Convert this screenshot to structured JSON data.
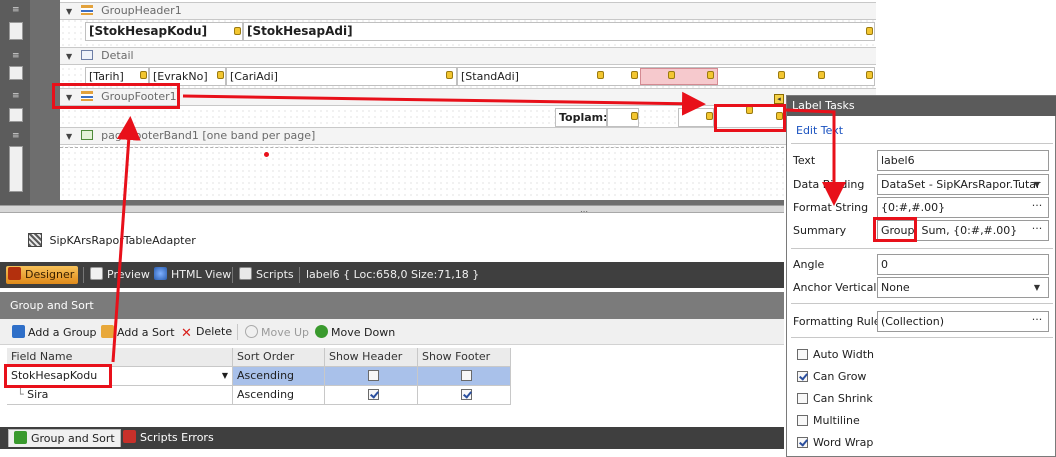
{
  "bands": {
    "group_header": "GroupHeader1",
    "detail": "Detail",
    "group_footer": "GroupFooter1",
    "page_footer": "pageFooterBand1 [one band per page]"
  },
  "header_fields": [
    "[StokHesapKodu]",
    "[StokHesapAdi]"
  ],
  "detail_fields": [
    "[Tarih]",
    "[EvrakNo]",
    "[CariAdi]",
    "[StandAdi]"
  ],
  "footer": {
    "total_label": "Toplam:"
  },
  "tray": {
    "adapter": "SipKArsRaporTableAdapter"
  },
  "designer_tabs": {
    "designer": "Designer",
    "preview": "Preview",
    "html_view": "HTML View",
    "scripts": "Scripts",
    "status": "label6 { Loc:658,0 Size:71,18 }"
  },
  "group_sort": {
    "title": "Group and Sort",
    "toolbar": {
      "add_group": "Add a Group",
      "add_sort": "Add a Sort",
      "delete": "Delete",
      "move_up": "Move Up",
      "move_down": "Move Down"
    },
    "columns": [
      "Field Name",
      "Sort Order",
      "Show Header",
      "Show Footer"
    ],
    "rows": [
      {
        "field": "StokHesapKodu",
        "order": "Ascending",
        "show_header": false,
        "show_footer": false
      },
      {
        "field": "Sira",
        "order": "Ascending",
        "show_header": true,
        "show_footer": true
      }
    ]
  },
  "bottom_tabs": {
    "group_sort": "Group and Sort",
    "scripts_errors": "Scripts Errors"
  },
  "label_tasks": {
    "title": "Label Tasks",
    "edit_text": "Edit Text",
    "text_label": "Text",
    "text_value": "label6",
    "data_binding_label": "Data Binding",
    "data_binding_value": "DataSet - SipKArsRapor.Tutar",
    "format_string_label": "Format String",
    "format_string_value": "{0:#,#.00}",
    "summary_label": "Summary",
    "summary_value": "Group, Sum, {0:#,#.00}",
    "angle_label": "Angle",
    "angle_value": "0",
    "anchor_label": "Anchor Vertically",
    "anchor_value": "None",
    "formatting_rules_label": "Formatting Rules",
    "formatting_rules_value": "(Collection)",
    "checks": [
      {
        "label": "Auto Width",
        "checked": false
      },
      {
        "label": "Can Grow",
        "checked": true
      },
      {
        "label": "Can Shrink",
        "checked": false
      },
      {
        "label": "Multiline",
        "checked": false
      },
      {
        "label": "Word Wrap",
        "checked": true
      }
    ]
  },
  "colors": {
    "accent_orange": "#e08a1a",
    "annotation_red": "#e8101a",
    "selection_blue": "#a9c1ea"
  }
}
